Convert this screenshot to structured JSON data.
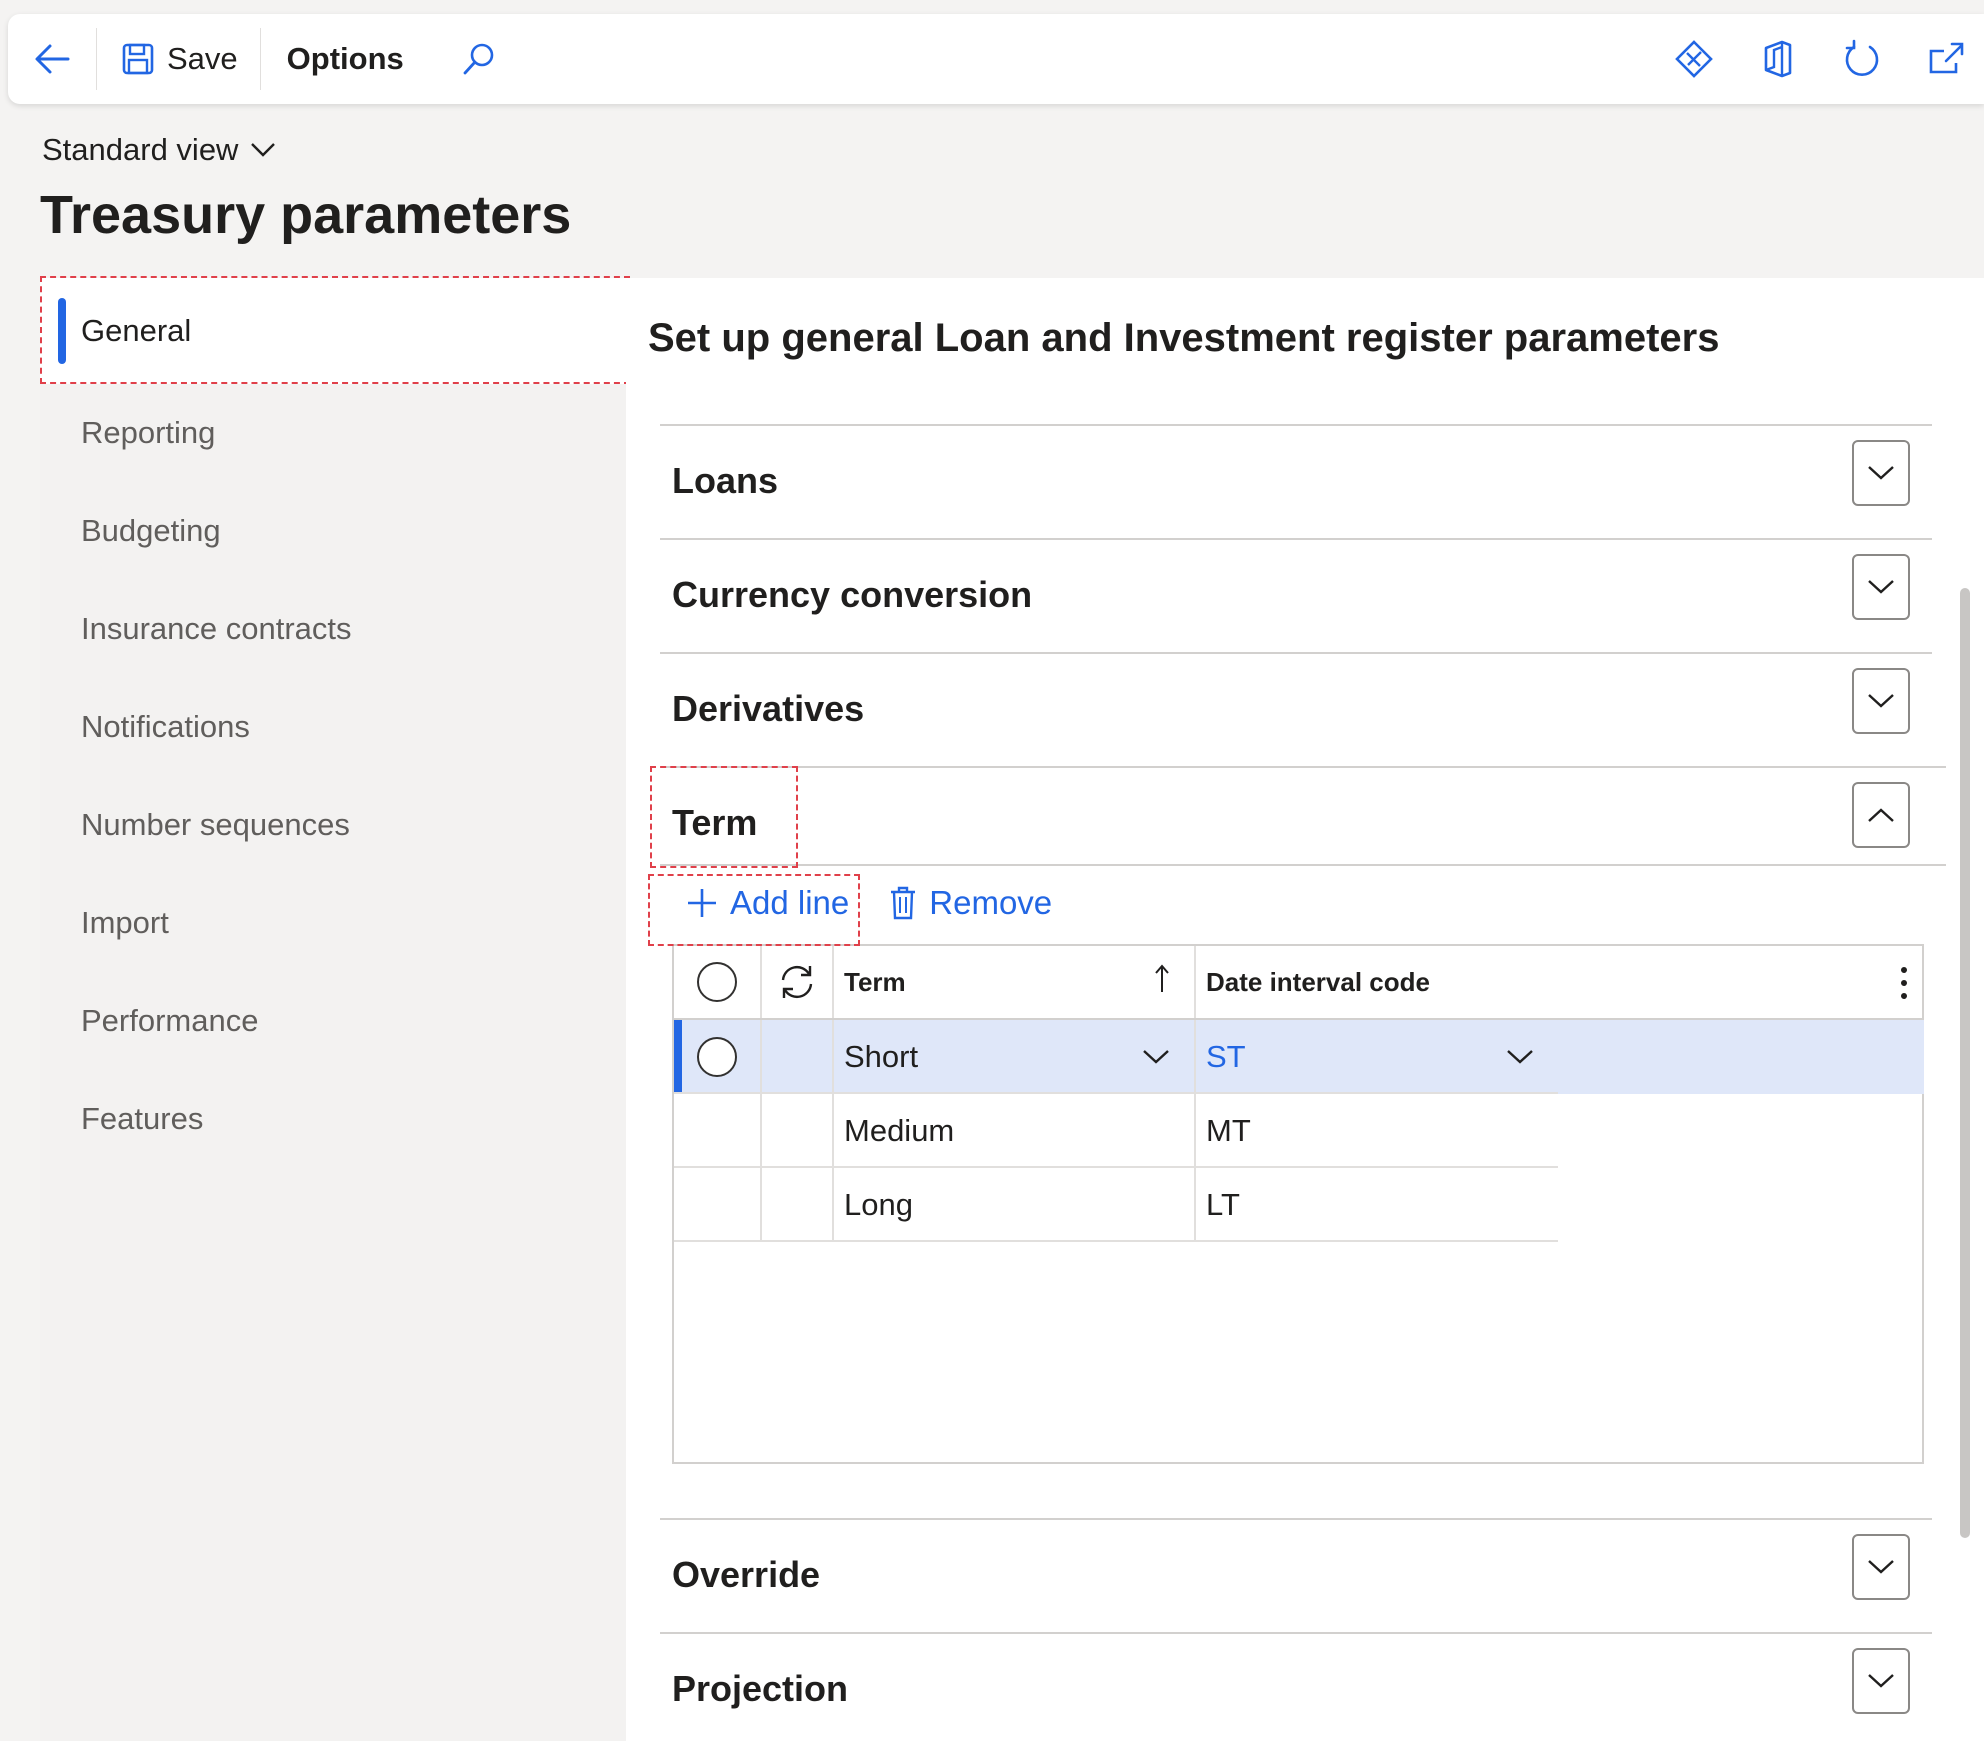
{
  "command_bar": {
    "save_label": "Save",
    "options_label": "Options",
    "icons": [
      "back-arrow-icon",
      "save-icon",
      "search-icon",
      "diamond-icon",
      "office-icon",
      "refresh-icon",
      "popout-icon"
    ]
  },
  "header": {
    "view_label": "Standard view",
    "title": "Treasury parameters"
  },
  "nav": {
    "items": [
      {
        "label": "General"
      },
      {
        "label": "Reporting"
      },
      {
        "label": "Budgeting"
      },
      {
        "label": "Insurance contracts"
      },
      {
        "label": "Notifications"
      },
      {
        "label": "Number sequences"
      },
      {
        "label": "Import"
      },
      {
        "label": "Performance"
      },
      {
        "label": "Features"
      }
    ],
    "active": "General"
  },
  "main": {
    "heading": "Set up general Loan and Investment register parameters",
    "fasttabs": {
      "loans": "Loans",
      "currency_conversion": "Currency conversion",
      "derivatives": "Derivatives",
      "term": "Term",
      "override": "Override",
      "projection": "Projection"
    },
    "term_grid": {
      "toolbar": {
        "add_line": "Add line",
        "remove": "Remove"
      },
      "columns": {
        "term": "Term",
        "date_interval_code": "Date interval code"
      },
      "rows": [
        {
          "term": "Short",
          "code": "ST",
          "selected": true
        },
        {
          "term": "Medium",
          "code": "MT",
          "selected": false
        },
        {
          "term": "Long",
          "code": "LT",
          "selected": false
        }
      ]
    }
  },
  "colors": {
    "accent": "#2266e3",
    "selected_row": "#dfe7f9",
    "highlight_box": "#e0404a"
  }
}
